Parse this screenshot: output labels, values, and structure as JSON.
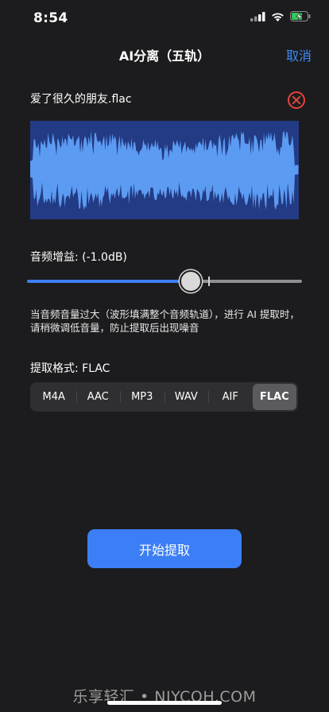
{
  "status_bar": {
    "time": "8:54"
  },
  "nav": {
    "title": "AI分离（五轨）",
    "cancel_label": "取消"
  },
  "file": {
    "name": "爱了很久的朋友.flac"
  },
  "gain": {
    "label": "音频增益:  (-1.0dB)",
    "value_fraction": 0.59,
    "marker_fraction": 0.66
  },
  "hint": {
    "text": "当音频音量过大（波形填满整个音频轨道），进行 AI 提取时，请稍微调低音量，防止提取后出现噪音"
  },
  "format": {
    "label": "提取格式: FLAC",
    "options": [
      "M4A",
      "AAC",
      "MP3",
      "WAV",
      "AIF",
      "FLAC"
    ],
    "selected": "FLAC"
  },
  "start_label": "开始提取",
  "watermark": "乐享轻汇 • NJYCQH.COM",
  "colors": {
    "accent": "#3d7ff2",
    "waveform": "#5c9bf2",
    "waveform_bg": "#233b84",
    "remove_icon": "#e5443a"
  }
}
